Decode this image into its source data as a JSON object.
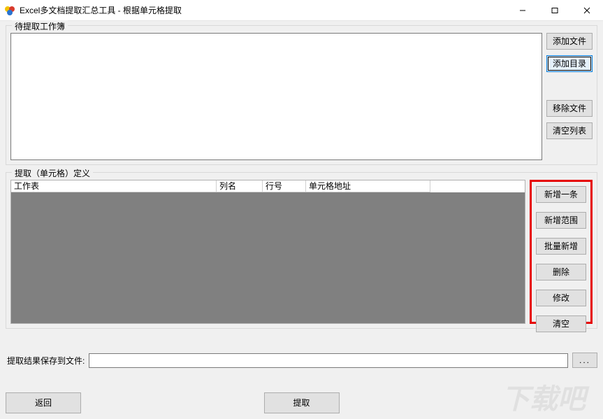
{
  "window": {
    "title": "Excel多文档提取汇总工具 - 根据单元格提取"
  },
  "group1": {
    "legend": "待提取工作簿",
    "buttons": {
      "add_file": "添加文件",
      "add_dir": "添加目录",
      "remove": "移除文件",
      "clear": "清空列表"
    }
  },
  "group2": {
    "legend": "提取（单元格）定义",
    "columns": {
      "worksheet": "工作表",
      "colname": "列名",
      "rownum": "行号",
      "celladdr": "单元格地址"
    },
    "buttons": {
      "add_one": "新增一条",
      "add_range": "新增范围",
      "batch_add": "批量新增",
      "delete": "删除",
      "edit": "修改",
      "clear": "清空"
    }
  },
  "save": {
    "label": "提取结果保存到文件:",
    "value": "",
    "browse": "..."
  },
  "bottom": {
    "back": "返回",
    "extract": "提取"
  },
  "watermark": "下载吧"
}
